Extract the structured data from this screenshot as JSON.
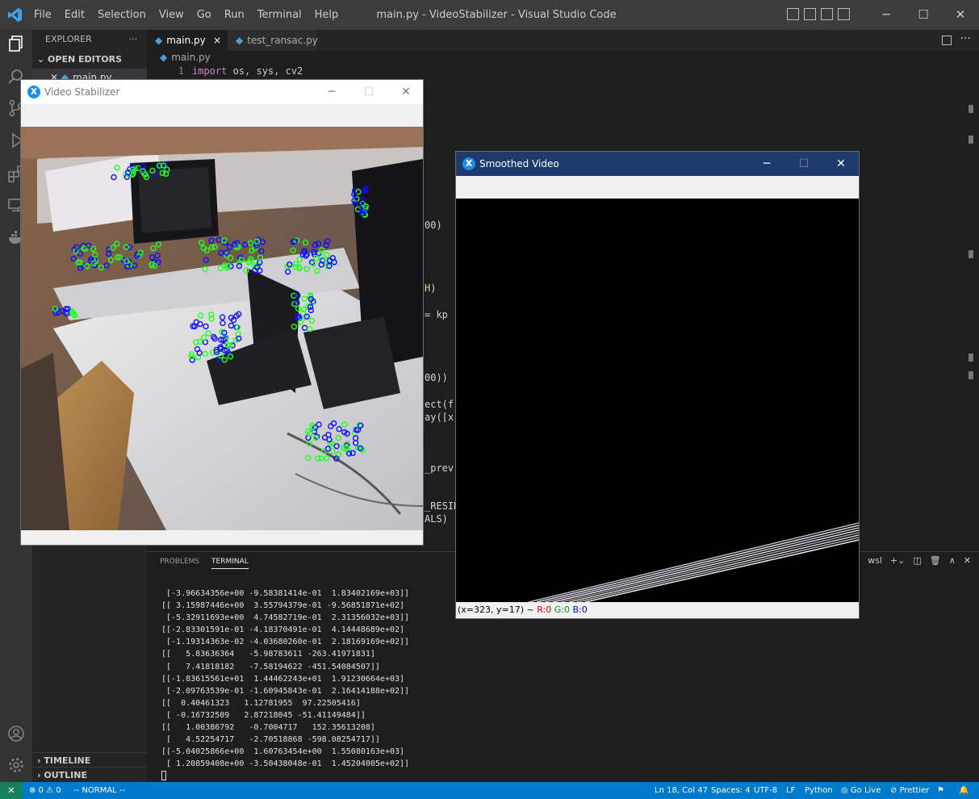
{
  "vscode": {
    "menu": [
      "File",
      "Edit",
      "Selection",
      "View",
      "Go",
      "Run",
      "Terminal",
      "Help"
    ],
    "title": "main.py - VideoStabilizer - Visual Studio Code",
    "sidebar": {
      "header": "EXPLORER",
      "more": "···",
      "open_editors": "OPEN EDITORS",
      "open_file": "main.py",
      "timeline": "TIMELINE",
      "outline": "OUTLINE"
    },
    "tabs": [
      {
        "label": "main.py",
        "close": "×"
      },
      {
        "label": "test_ransac.py"
      }
    ],
    "breadcrumb": "main.py",
    "code_line": {
      "number": "1",
      "keyword": "import",
      "rest": " os, sys, cv2"
    },
    "code_fragments": [
      "00)",
      "H)",
      "= kp",
      "00))",
      "ect(fr",
      "ay([x.",
      "_prev,",
      "_RESID",
      "ALS)"
    ],
    "panel": {
      "tabs": [
        "PROBLEMS",
        "TERMINAL"
      ],
      "shell": "wsl",
      "terminal_lines": [
        " [-3.96634356e+00 -9.58381414e-01  1.83402169e+03]]",
        "[[ 3.15987446e+00  3.55794379e-01 -9.56851871e+02]",
        " [-5.32911693e+00  4.74582719e-01  2.31356032e+03]]",
        "[[-2.83301591e-01 -4.18370491e-01  4.14448689e+02]",
        " [-1.19314363e-02 -4.03680260e-01  2.18169169e+02]]",
        "[[   5.83636364   -5.98783611 -263.41971831]",
        " [   7.41818182   -7.58194622 -451.54084507]]",
        "[[-1.83615561e+01  1.44462243e+01  1.91230664e+03]",
        " [-2.09763539e-01 -1.60945843e-01  2.16414188e+02]]",
        "[[  0.40461323   1.12781955  97.22505416]",
        " [ -0.16732509   2.87218045 -51.41149484]]",
        "[[   1.00386792   -0.7004717   152.35613208]",
        " [   4.52254717   -2.70518868 -598.08254717]]",
        "[[-5.04025866e+00  1.60763454e+00  1.55080163e+03]",
        " [ 1.20859408e+00 -3.50438048e-01  1.45204005e+02]]"
      ]
    },
    "status": {
      "remote": "✕",
      "problems": "⊗ 0 ⚠ 0",
      "mode": "-- NORMAL --",
      "position": "Ln 18, Col 47",
      "spaces": "Spaces: 4",
      "encoding": "UTF-8",
      "eol": "LF",
      "language": "Python",
      "golive": "Go Live",
      "prettier": "Prettier"
    }
  },
  "stabilizer_window": {
    "title": "Video Stabilizer",
    "logo": "X",
    "colors": {
      "inlier": "#22ff22",
      "outlier": "#1010ff"
    }
  },
  "smoothed_window": {
    "title": "Smoothed Video",
    "logo": "X",
    "status_coords": "(x=323, y=17) ~",
    "r": "R:0",
    "g": "G:0",
    "b": "B:0"
  }
}
